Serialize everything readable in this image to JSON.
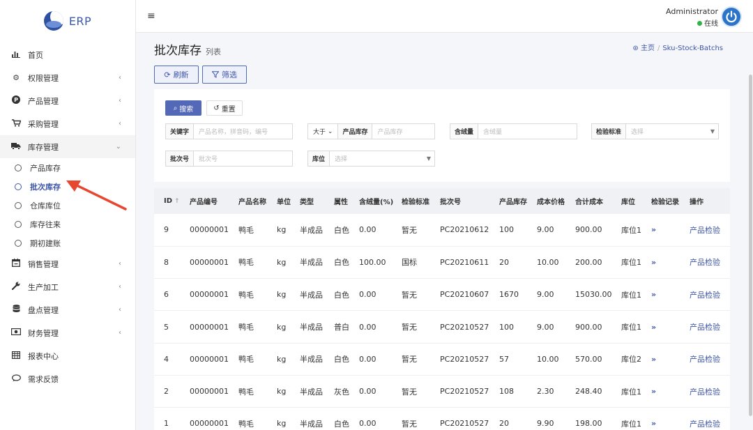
{
  "brand": {
    "name": "ERP"
  },
  "sidebar": {
    "items": [
      {
        "label": "首页",
        "icon": "chart-icon"
      },
      {
        "label": "权限管理",
        "icon": "gear-icon"
      },
      {
        "label": "产品管理",
        "icon": "product-icon"
      },
      {
        "label": "采购管理",
        "icon": "cart-icon"
      },
      {
        "label": "库存管理",
        "icon": "truck-icon"
      },
      {
        "label": "销售管理",
        "icon": "calendar-icon"
      },
      {
        "label": "生产加工",
        "icon": "wrench-icon"
      },
      {
        "label": "盘点管理",
        "icon": "database-icon"
      },
      {
        "label": "财务管理",
        "icon": "money-icon"
      },
      {
        "label": "报表中心",
        "icon": "table-icon"
      },
      {
        "label": "需求反馈",
        "icon": "comment-icon"
      }
    ],
    "sub_items": [
      {
        "label": "产品库存"
      },
      {
        "label": "批次库存"
      },
      {
        "label": "仓库库位"
      },
      {
        "label": "库存往来"
      },
      {
        "label": "期初建账"
      }
    ]
  },
  "topbar": {
    "user_name": "Administrator",
    "user_status": "在线"
  },
  "page": {
    "title": "批次库存",
    "subtitle": "列表",
    "breadcrumb_home": "主页",
    "breadcrumb_current": "Sku-Stock-Batchs"
  },
  "toolbar": {
    "refresh_label": "刷新",
    "filter_label": "筛选"
  },
  "search": {
    "search_label": "搜索",
    "reset_label": "重置",
    "keyword_label": "关键字",
    "keyword_placeholder": "产品名称，拼音码，编号",
    "compare_value": "大于",
    "stock_label": "产品库存",
    "stock_placeholder": "产品库存",
    "down_label": "含绒量",
    "down_placeholder": "含绒量",
    "standard_label": "检验标准",
    "standard_placeholder": "选择",
    "batch_label": "批次号",
    "batch_placeholder": "批次号",
    "location_label": "库位",
    "location_placeholder": "选择"
  },
  "table": {
    "headers": [
      "ID",
      "产品编号",
      "产品名称",
      "单位",
      "类型",
      "属性",
      "含绒量(%)",
      "检验标准",
      "批次号",
      "产品库存",
      "成本价格",
      "合计成本",
      "库位",
      "检验记录",
      "操作"
    ],
    "rows": [
      [
        "9",
        "00000001",
        "鸭毛",
        "kg",
        "半成品",
        "白色",
        "0.00",
        "暂无",
        "PC20210612",
        "100",
        "9.00",
        "900.00",
        "库位1",
        "»",
        "产品检验"
      ],
      [
        "8",
        "00000001",
        "鸭毛",
        "kg",
        "半成品",
        "白色",
        "100.00",
        "国标",
        "PC20210611",
        "20",
        "10.00",
        "200.00",
        "库位1",
        "»",
        "产品检验"
      ],
      [
        "6",
        "00000001",
        "鸭毛",
        "kg",
        "半成品",
        "白色",
        "0.00",
        "暂无",
        "PC20210607",
        "1670",
        "9.00",
        "15030.00",
        "库位1",
        "»",
        "产品检验"
      ],
      [
        "5",
        "00000001",
        "鸭毛",
        "kg",
        "半成品",
        "普白",
        "0.00",
        "暂无",
        "PC20210527",
        "100",
        "9.00",
        "900.00",
        "库位1",
        "»",
        "产品检验"
      ],
      [
        "4",
        "00000001",
        "鸭毛",
        "kg",
        "半成品",
        "白色",
        "0.00",
        "暂无",
        "PC20210527",
        "57",
        "10.00",
        "570.00",
        "库位2",
        "»",
        "产品检验"
      ],
      [
        "2",
        "00000001",
        "鸭毛",
        "kg",
        "半成品",
        "灰色",
        "0.00",
        "暂无",
        "PC20210527",
        "108",
        "2.30",
        "248.40",
        "库位1",
        "»",
        "产品检验"
      ],
      [
        "1",
        "00000001",
        "鸭毛",
        "kg",
        "半成品",
        "白色",
        "0.00",
        "暂无",
        "PC20210527",
        "20",
        "9.90",
        "198.00",
        "库位1",
        "»",
        "产品检验"
      ]
    ]
  },
  "colors": {
    "accent": "#3d55a8",
    "primary_button": "#5368b7",
    "annotation_arrow": "#e8472f",
    "online": "#2fb344"
  }
}
